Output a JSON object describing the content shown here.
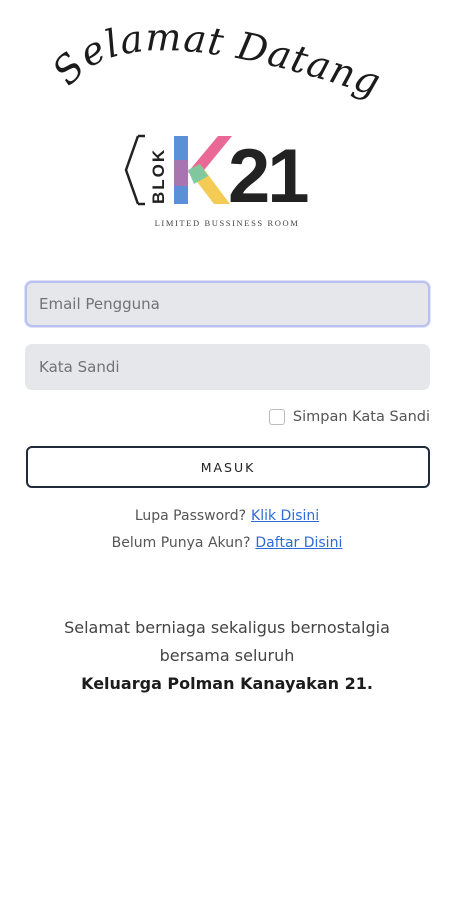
{
  "header": {
    "welcome_text": "Selamat Datang",
    "logo": {
      "brand_vertical": "BLOK",
      "brand_mark": "K",
      "brand_number": "21",
      "tagline": "LIMITED BUSSINESS ROOM",
      "colors": {
        "k_blue": "#5b8fd8",
        "k_pink": "#e8608f",
        "k_yellow": "#f3c84b",
        "k_green": "#79c7a1",
        "dark": "#222222"
      }
    }
  },
  "form": {
    "email_placeholder": "Email Pengguna",
    "password_placeholder": "Kata Sandi",
    "remember_label": "Simpan Kata Sandi",
    "remember_checked": false,
    "submit_label": "MASUK"
  },
  "links": {
    "forgot_prefix": "Lupa Password?",
    "forgot_link": "Klik Disini",
    "register_prefix": "Belum Punya Akun?",
    "register_link": "Daftar Disini"
  },
  "footer": {
    "line1": "Selamat berniaga sekaligus bernostalgia",
    "line2": "bersama seluruh",
    "line3": "Keluarga Polman Kanayakan 21."
  },
  "theme": {
    "input_bg": "#e6e7ea",
    "focus_border": "#b9c1f2",
    "button_border": "#1f2a3a",
    "link_color": "#2e6bd6"
  }
}
